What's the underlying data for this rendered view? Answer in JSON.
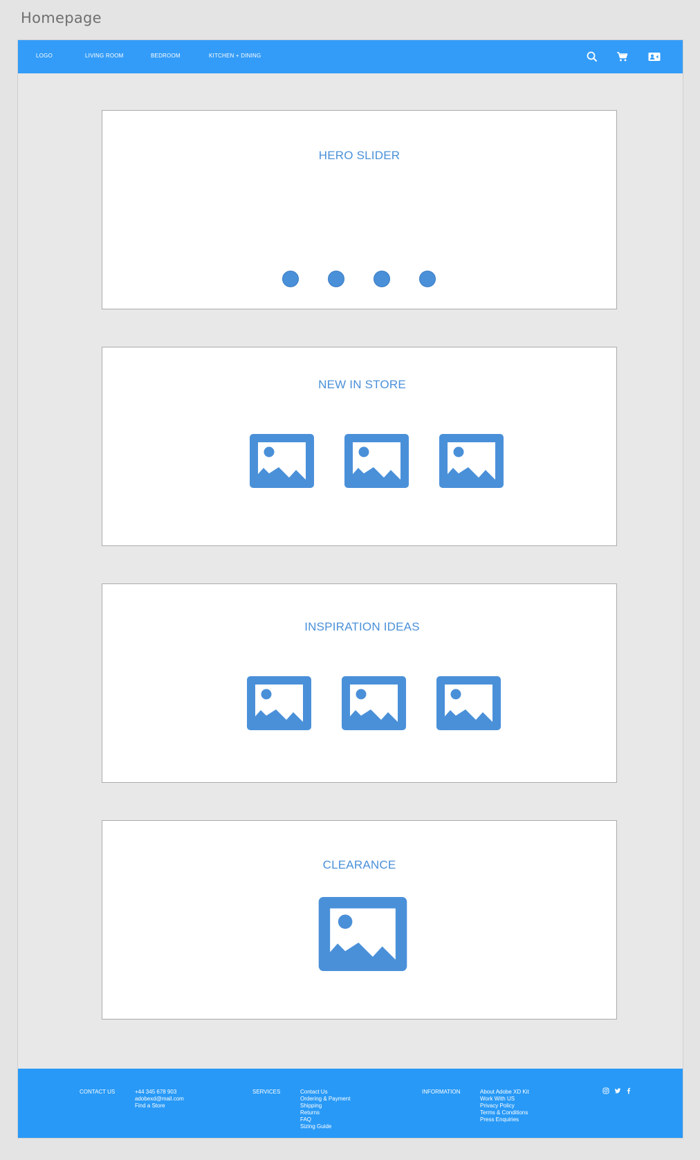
{
  "page_label": "Homepage",
  "nav": {
    "logo": "LOGO",
    "items": [
      "LIVING ROOM",
      "BEDROOM",
      "KITCHEN + DINING"
    ],
    "icons": [
      "search-icon",
      "cart-icon",
      "account-card-icon"
    ]
  },
  "sections": {
    "hero": {
      "title": "HERO SLIDER",
      "slide_count": 4
    },
    "new_in_store": {
      "title": "NEW IN STORE",
      "image_count": 3
    },
    "inspiration": {
      "title": "INSPIRATION IDEAS",
      "image_count": 3
    },
    "clearance": {
      "title": "CLEARANCE",
      "image_count": 1
    }
  },
  "footer": {
    "contact": {
      "heading": "CONTACT US",
      "lines": [
        "+44 345 678 903",
        "adobexd@mail.com",
        "Find a Store"
      ]
    },
    "services": {
      "heading": "SERVICES",
      "lines": [
        "Contact Us",
        "Ordering & Payment",
        "Shipping",
        "Returns",
        "FAQ",
        "Sizing Guide"
      ]
    },
    "information": {
      "heading": "INFORMATION",
      "lines": [
        "About Adobe XD Kit",
        "Work With US",
        "Privacy Policy",
        "Terms & Conditions",
        "Press Enquiries"
      ]
    },
    "social_icons": [
      "instagram-icon",
      "twitter-icon",
      "facebook-icon"
    ]
  },
  "colors": {
    "nav_bg": "#339cf8",
    "footer_bg": "#2899f7",
    "accent": "#4a90d9",
    "canvas": "#e8e8e8"
  }
}
